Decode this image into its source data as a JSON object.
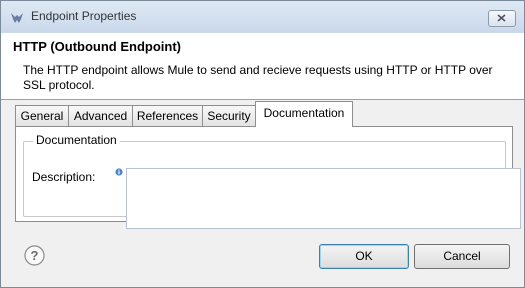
{
  "window": {
    "title": "Endpoint Properties"
  },
  "header": {
    "title": "HTTP (Outbound Endpoint)",
    "description": "The HTTP endpoint allows Mule to send and recieve requests using HTTP or HTTP over SSL protocol."
  },
  "tabs": [
    {
      "label": "General"
    },
    {
      "label": "Advanced"
    },
    {
      "label": "References"
    },
    {
      "label": "Security"
    },
    {
      "label": "Documentation",
      "active": true
    }
  ],
  "documentation": {
    "group_label": "Documentation",
    "description_label": "Description:",
    "description_value": ""
  },
  "buttons": {
    "ok": "OK",
    "cancel": "Cancel"
  },
  "icons": {
    "app": "mule-icon",
    "close": "close-icon",
    "help": "help-icon",
    "info": "info-icon"
  }
}
